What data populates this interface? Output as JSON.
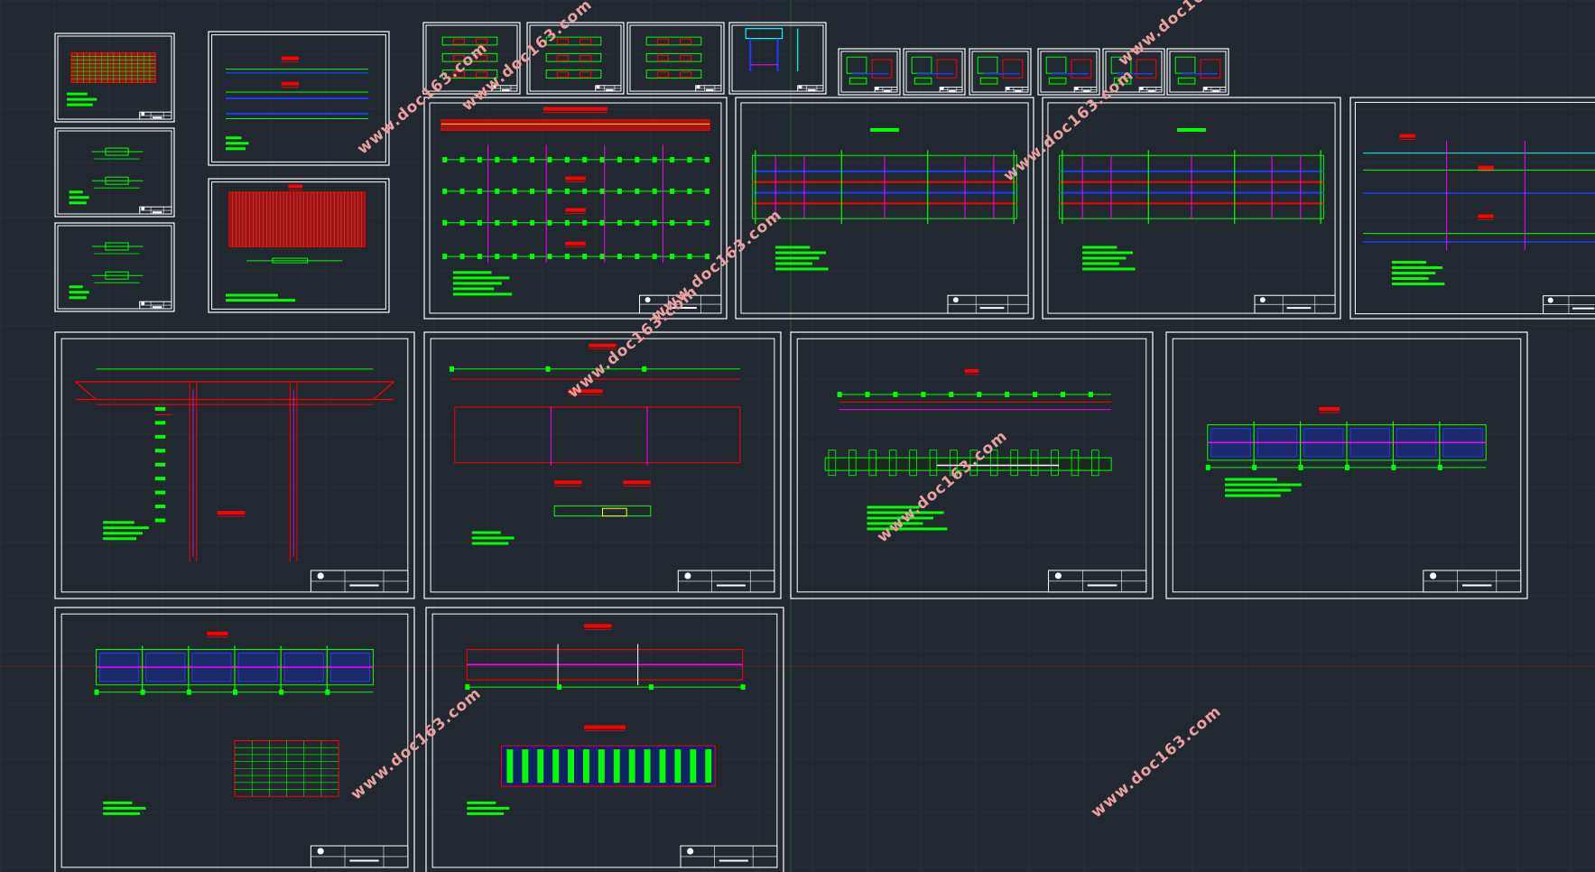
{
  "app": {
    "name": "CAD drawing model space"
  },
  "watermark": {
    "text": "www.doc163.com"
  },
  "colors": {
    "background": "#212830",
    "grid": "#2a323b",
    "frame": "#ffffff",
    "green": "#00ff00",
    "red": "#ff0000",
    "blue": "#1e3cff",
    "magenta": "#ff00ff",
    "cyan": "#00ffff",
    "yellow": "#ffff00",
    "watermark": "#e8a0a0"
  },
  "sheets": [
    {
      "id": "sheet-1",
      "kind": "table"
    },
    {
      "id": "sheet-2",
      "kind": "section"
    },
    {
      "id": "sheet-3",
      "kind": "section"
    },
    {
      "id": "sheet-4",
      "kind": "elevation"
    },
    {
      "id": "sheet-5",
      "kind": "hatch"
    },
    {
      "id": "sheet-6",
      "kind": "detail"
    },
    {
      "id": "sheet-7",
      "kind": "detail"
    },
    {
      "id": "sheet-8",
      "kind": "detail"
    },
    {
      "id": "sheet-9",
      "kind": "detail-cyan"
    },
    {
      "id": "sheet-10",
      "kind": "detail-small"
    },
    {
      "id": "sheet-11",
      "kind": "detail-small"
    },
    {
      "id": "sheet-12",
      "kind": "detail-small"
    },
    {
      "id": "sheet-13",
      "kind": "detail-small"
    },
    {
      "id": "sheet-14",
      "kind": "detail-small"
    },
    {
      "id": "sheet-15",
      "kind": "detail-small"
    },
    {
      "id": "sheet-16",
      "kind": "long-elevation"
    },
    {
      "id": "sheet-17",
      "kind": "plan-bands"
    },
    {
      "id": "sheet-18",
      "kind": "plan-bands"
    },
    {
      "id": "sheet-19",
      "kind": "plan-lines"
    },
    {
      "id": "sheet-20",
      "kind": "pier"
    },
    {
      "id": "sheet-21",
      "kind": "plan-sections"
    },
    {
      "id": "sheet-22",
      "kind": "girder-long"
    },
    {
      "id": "sheet-23",
      "kind": "plan-blocks"
    },
    {
      "id": "sheet-24",
      "kind": "plan-blocks-table"
    },
    {
      "id": "sheet-25",
      "kind": "plan-table"
    }
  ]
}
